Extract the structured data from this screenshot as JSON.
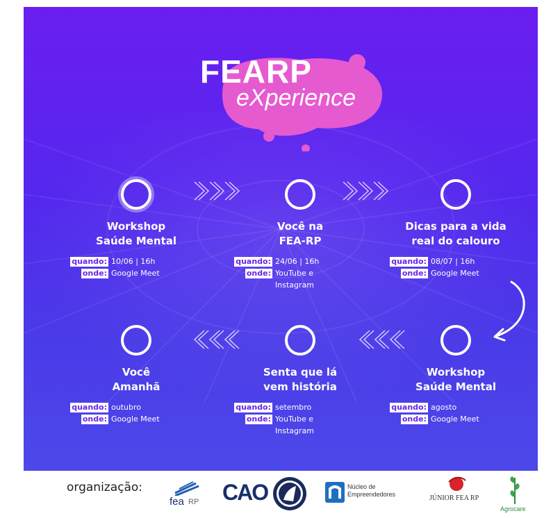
{
  "logo": {
    "title": "FEARP",
    "subtitle": "eXperience"
  },
  "labels": {
    "when": "quando:",
    "where": "onde:"
  },
  "events": [
    {
      "title": "Workshop\nSaúde Mental",
      "when": "10/06 | 16h",
      "where": "Google Meet"
    },
    {
      "title": "Você na\nFEA-RP",
      "when": "24/06 | 16h",
      "where": "YouTube e\nInstagram"
    },
    {
      "title": "Dicas para a vida\nreal do calouro",
      "when": "08/07 | 16h",
      "where": "Google Meet"
    },
    {
      "title": "Workshop\nSaúde Mental",
      "when": "agosto",
      "where": "Google Meet"
    },
    {
      "title": "Senta que lá\nvem história",
      "when": "setembro",
      "where": "YouTube e\nInstagram"
    },
    {
      "title": "Você\nAmanhã",
      "when": "outubro",
      "where": "Google Meet"
    }
  ],
  "footer": {
    "label": "organização:",
    "logos": {
      "fea": "fea",
      "fea_rp": "RP",
      "cao": "CAO",
      "nucleo_1": "Núcleo de",
      "nucleo_2": "Empreendedores",
      "junior": "JÚNIOR FEA RP",
      "agrocare": "Agrocare"
    }
  },
  "colors": {
    "accent": "#6a24e8",
    "blob": "#e65ad0"
  }
}
